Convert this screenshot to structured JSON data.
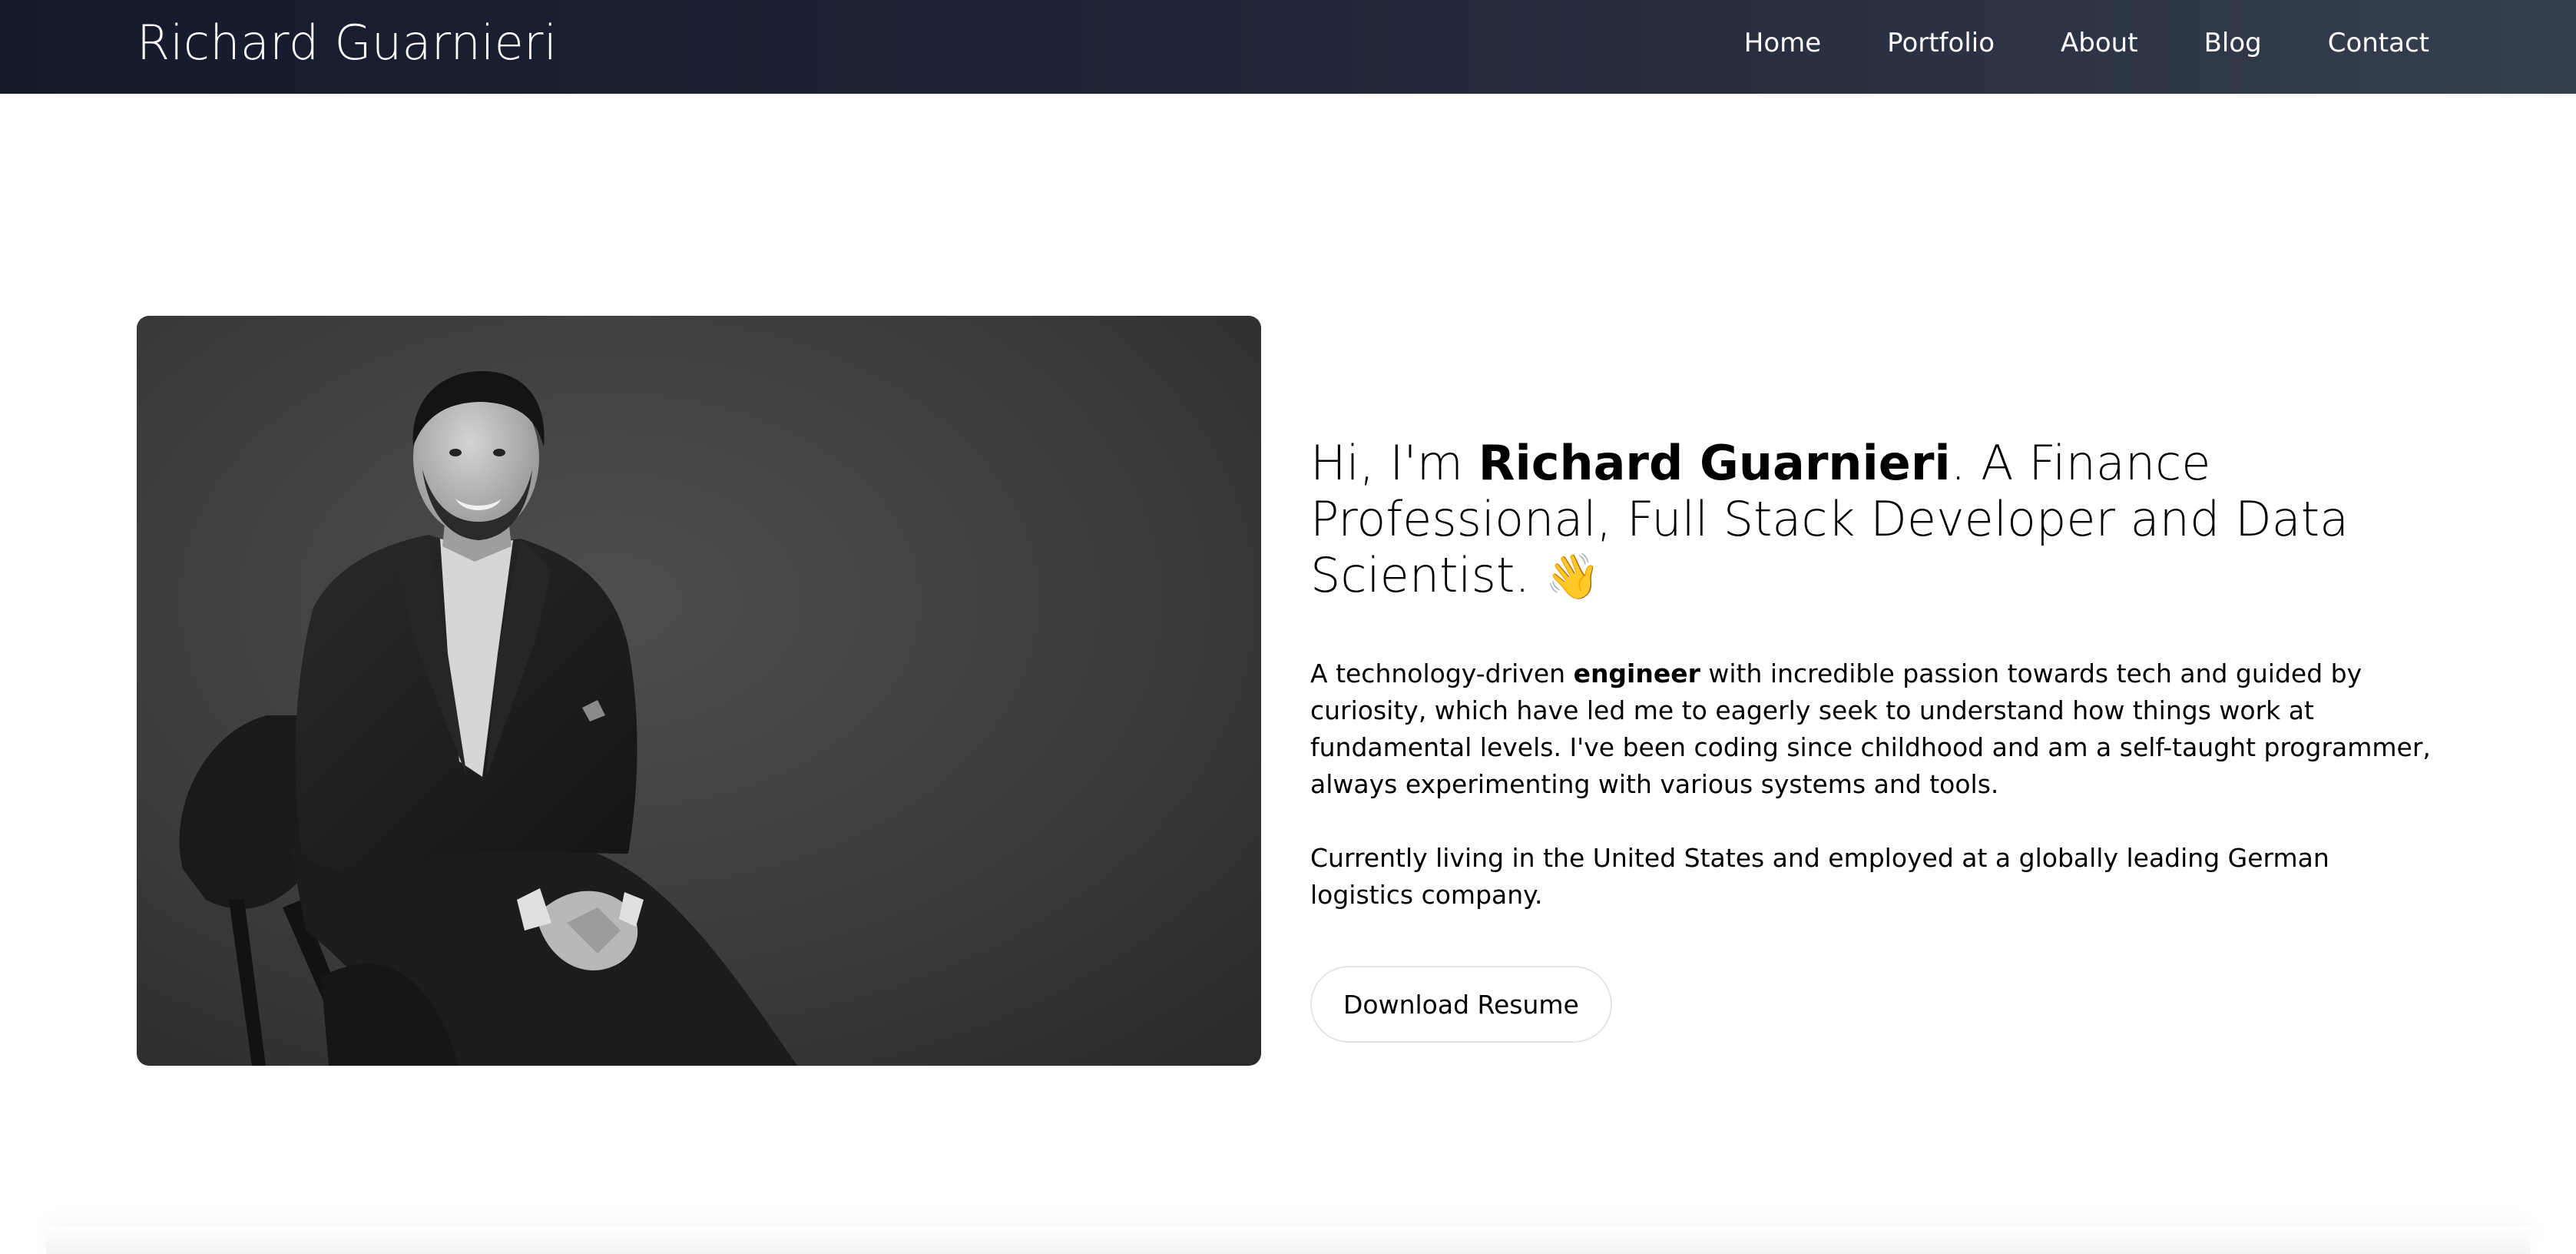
{
  "nav": {
    "brand": "Richard Guarnieri",
    "links": [
      "Home",
      "Portfolio",
      "About",
      "Blog",
      "Contact"
    ]
  },
  "hero": {
    "photo_icon": "portrait-photo",
    "headline": {
      "prefix": "Hi, I'm ",
      "name": "Richard Guarnieri",
      "suffix": ". A Finance Professional, Full Stack Developer and Data Scientist. ",
      "emoji": "👋"
    },
    "bio": {
      "p1_before": "A technology-driven ",
      "p1_bold": "engineer",
      "p1_after": " with incredible passion towards tech and guided by curiosity, which have led me to eagerly seek to understand how things work at fundamental levels. I've been coding since childhood and am a self-taught programmer, always experimenting with various systems and tools.",
      "p2": "Currently living in the United States and employed at a globally leading German logistics company."
    },
    "resume_button": "Download Resume"
  },
  "colors": {
    "nav_start": "#151b2c",
    "nav_end": "#364150",
    "text": "#000000",
    "button_border": "#e4e4e4"
  }
}
